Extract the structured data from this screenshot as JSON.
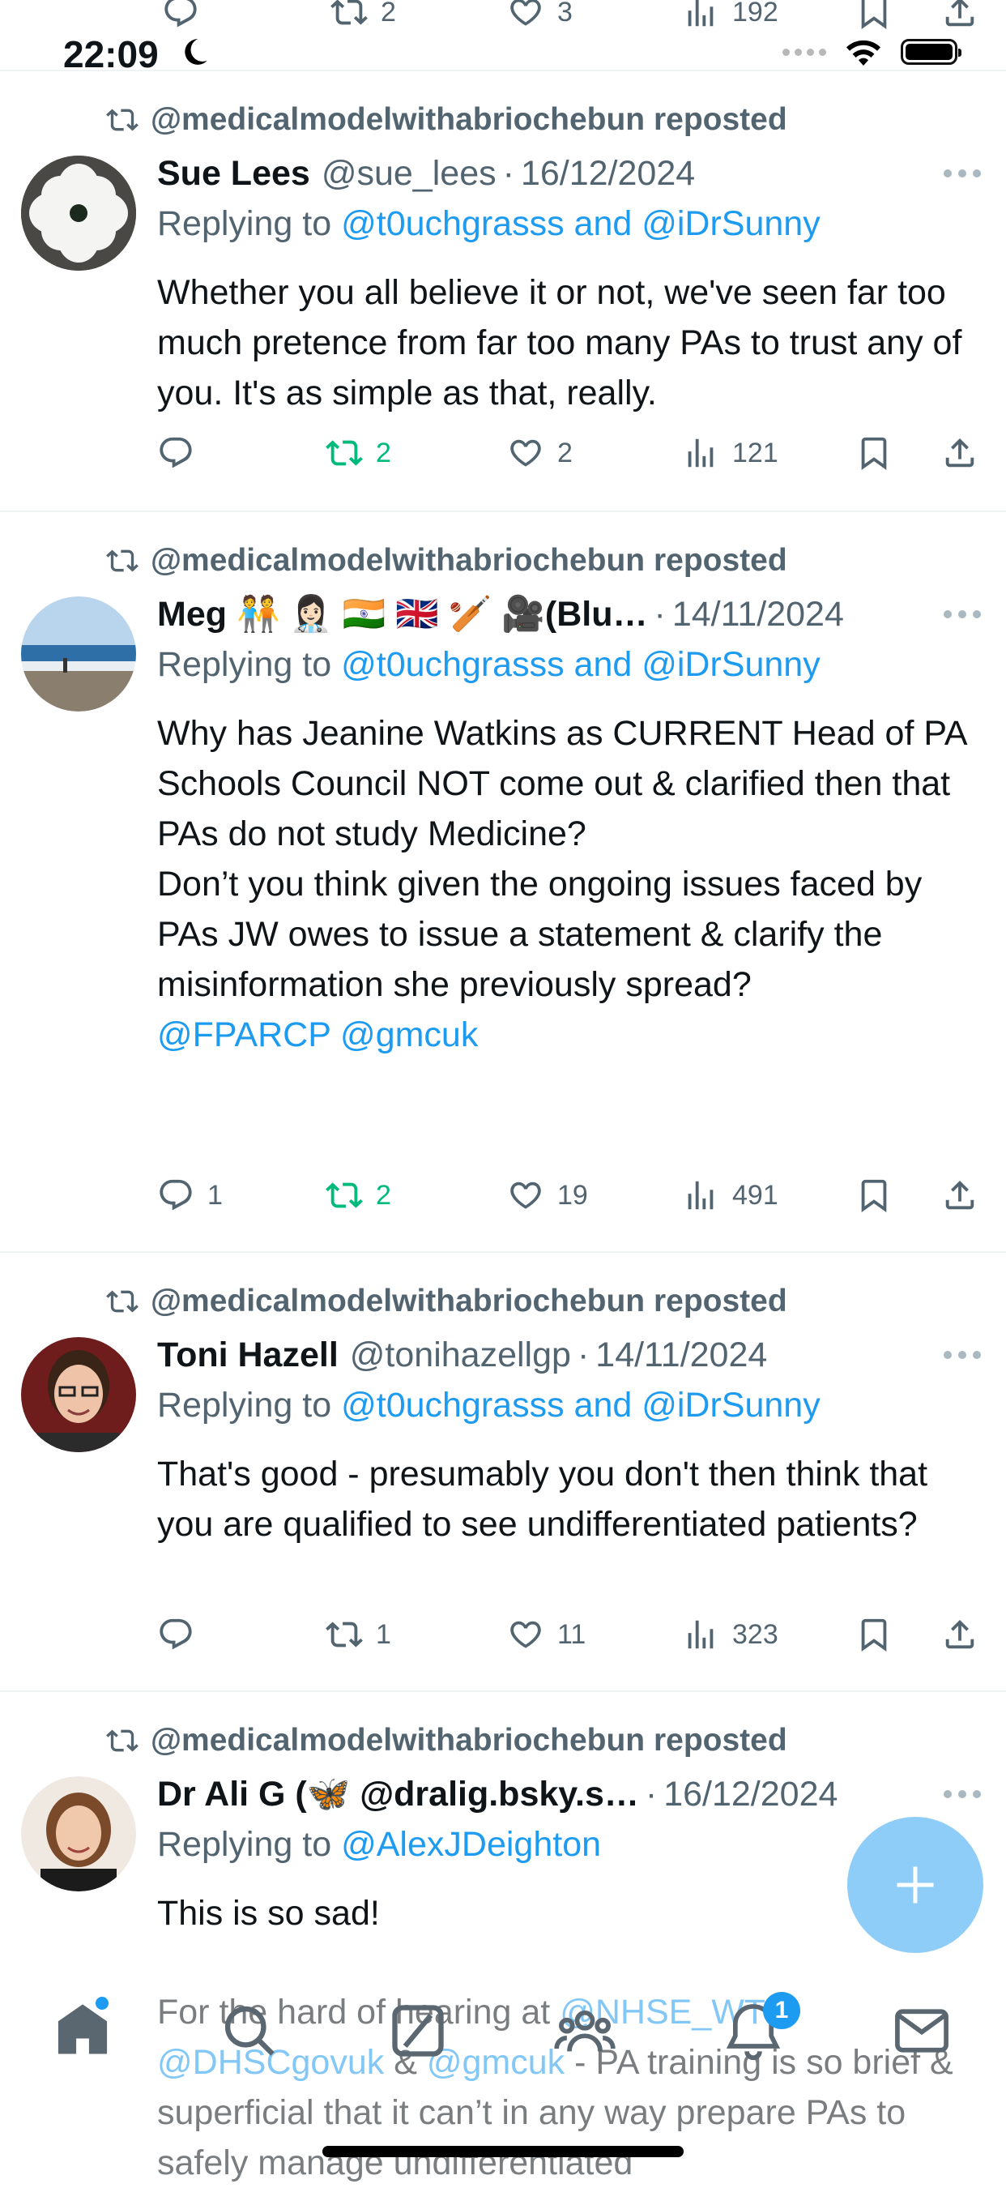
{
  "status_bar": {
    "time": "22:09"
  },
  "top_partial_actions": {
    "retweets": "2",
    "likes": "3",
    "views": "192"
  },
  "posts": [
    {
      "repost_label": "@medicalmodelwithabriochebun reposted",
      "name": "Sue Lees",
      "handle": "@sue_lees",
      "date": "16/12/2024",
      "replying_prefix": "Replying to",
      "replying_to": "@t0uchgrasss and @iDrSunny",
      "text": "Whether you all believe it or not, we've seen far too much pretence from far too many PAs to trust any of you. It's as simple as that, really.",
      "replies": "",
      "retweets": "2",
      "likes": "2",
      "views": "121"
    },
    {
      "repost_label": "@medicalmodelwithabriochebun reposted",
      "name": "Meg 🧑‍🤝‍🧑 👩🏻‍⚕️ 🇮🇳 🇬🇧 🏏 🎥(Blu…",
      "handle": "",
      "date": "14/11/2024",
      "replying_prefix": "Replying to",
      "replying_to": "@t0uchgrasss and @iDrSunny",
      "text_p1": "Why has Jeanine Watkins as CURRENT Head of PA Schools Council NOT come out & clarified then that PAs do not study Medicine?",
      "text_p2": "Don’t you think given the ongoing issues faced by PAs JW owes to issue a statement & clarify the misinformation she previously spread?",
      "text_p3": "@FPARCP @gmcuk",
      "replies": "1",
      "retweets": "2",
      "likes": "19",
      "views": "491"
    },
    {
      "repost_label": "@medicalmodelwithabriochebun reposted",
      "name": "Toni Hazell",
      "handle": "@tonihazellgp",
      "date": "14/11/2024",
      "replying_prefix": "Replying to",
      "replying_to": "@t0uchgrasss and @iDrSunny",
      "text": "That's good - presumably you don't then think that you are qualified to see undifferentiated patients?",
      "replies": "",
      "retweets": "1",
      "likes": "11",
      "views": "323"
    },
    {
      "repost_label": "@medicalmodelwithabriochebun reposted",
      "name": "Dr Ali G (🦋 @dralig.bsky.s…",
      "handle": "",
      "date": "16/12/2024",
      "replying_prefix": "Replying to",
      "replying_to": "@AlexJDeighton",
      "text": "This is so sad!",
      "behind_a": "For the hard of hearing at ",
      "behind_b": "@NHSE_WTE",
      "behind_c": "@DHSCgovuk",
      "behind_d": " & ",
      "behind_e": "@gmcuk",
      "behind_f": " - PA training is so brief & superficial that it can’t in any way prepare PAs to safely manage undifferentiated"
    }
  ],
  "notifications_badge": "1",
  "colors": {
    "accent": "#1d9bf0",
    "repost_green": "#00ba7c",
    "muted": "#536471",
    "fab": "#8ecdf8"
  },
  "icons": [
    "reply-icon",
    "retweet-icon",
    "like-icon",
    "views-icon",
    "bookmark-icon",
    "share-icon",
    "more-icon",
    "home-icon",
    "search-icon",
    "grok-icon",
    "communities-icon",
    "notifications-icon",
    "messages-icon",
    "compose-icon"
  ]
}
